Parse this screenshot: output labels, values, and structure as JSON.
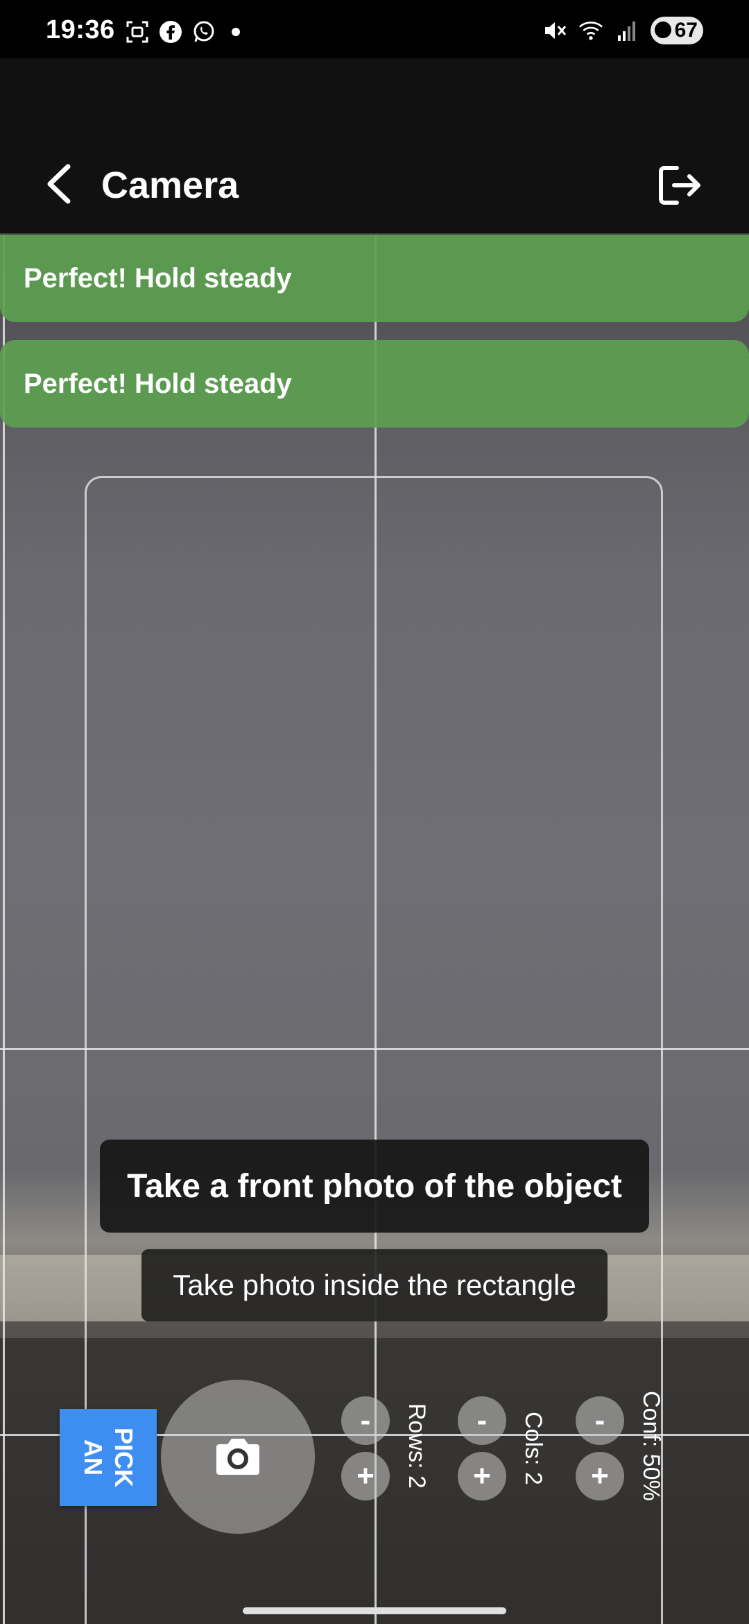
{
  "status_bar": {
    "time": "19:36",
    "battery": "67",
    "icons": [
      "screenshot-icon",
      "facebook-icon",
      "whatsapp-icon",
      "dot-icon",
      "mute-icon",
      "wifi-icon",
      "signal-icon",
      "battery-icon"
    ]
  },
  "app_bar": {
    "title": "Camera",
    "back_icon": "chevron-left-icon",
    "exit_icon": "logout-icon"
  },
  "banners": [
    {
      "text": "Perfect! Hold steady"
    },
    {
      "text": "Perfect! Hold steady"
    }
  ],
  "hints": {
    "main": "Take a front photo of the object",
    "sub": "Take photo inside the rectangle"
  },
  "controls": {
    "pick_label": "PICK\nAN",
    "rows_label": "Rows: 2",
    "cols_label": "Cols: 2",
    "conf_label": "Conf: 50%",
    "minus": "-",
    "plus": "+"
  },
  "colors": {
    "banner_green": "#5ca050",
    "pick_blue": "#3d8ef0"
  }
}
